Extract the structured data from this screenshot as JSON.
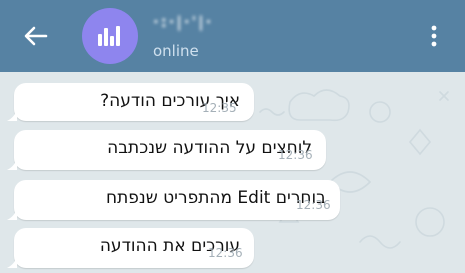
{
  "header": {
    "title": "·:·|·'|·",
    "status": "online",
    "back_icon": "arrow-left-icon",
    "menu_icon": "more-vertical-icon",
    "avatar_icon": "chart-bars-icon",
    "colors": {
      "bar": "#5682a3",
      "avatar": "#8e85ee",
      "status_text": "#cfe0ee"
    }
  },
  "messages": [
    {
      "text": "איך עורכים הודעה?",
      "time": "12:35"
    },
    {
      "text": "לוחצים על ההודעה שנכתבה",
      "time": "12:36"
    },
    {
      "text": "בוחרים Edit מהתפריט שנפתח",
      "time": "12:36"
    },
    {
      "text": "עורכים את ההודעה",
      "time": "12:36"
    }
  ],
  "chat": {
    "background_color": "#dfe7ea",
    "bubble_color": "#ffffff",
    "time_color": "#a5b0b8"
  }
}
